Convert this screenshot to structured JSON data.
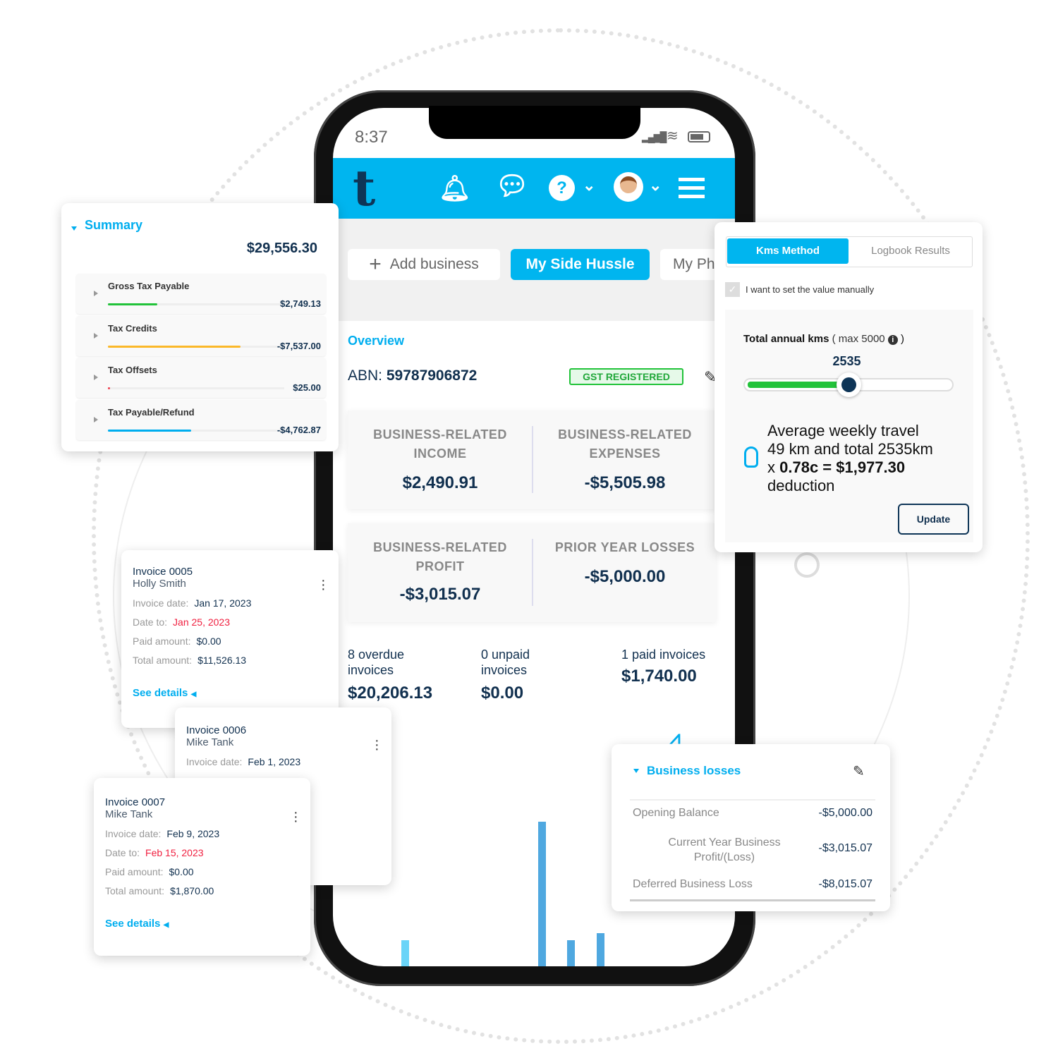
{
  "status_bar": {
    "time": "8:37"
  },
  "header": {
    "icons": [
      "logo-t",
      "bell-icon",
      "chat-icon",
      "help-icon",
      "avatar",
      "menu-icon"
    ],
    "help_glyph": "?"
  },
  "business_tabs": {
    "add": "Add business",
    "active": "My Side Hussle",
    "next": "My Ph"
  },
  "overview": {
    "title": "Overview",
    "abn_label": "ABN:",
    "abn": "59787906872",
    "badge": "GST REGISTERED",
    "stats": [
      {
        "label": "BUSINESS-RELATED INCOME",
        "value": "$2,490.91"
      },
      {
        "label": "BUSINESS-RELATED EXPENSES",
        "value": "-$5,505.98"
      },
      {
        "label": "BUSINESS-RELATED PROFIT",
        "value": "-$3,015.07"
      },
      {
        "label": "PRIOR YEAR LOSSES",
        "value": "-$5,000.00"
      }
    ],
    "invoices": [
      {
        "label": "8 overdue invoices",
        "value": "$20,206.13"
      },
      {
        "label": "0 unpaid invoices",
        "value": "$0.00"
      },
      {
        "label": "1 paid invoices",
        "value": "$1,740.00"
      }
    ]
  },
  "chart_bars": [
    0.18,
    1.0,
    0.18,
    0.23
  ],
  "summary": {
    "title": "Summary",
    "total": "$29,556.30",
    "rows": [
      {
        "label": "Gross Tax Payable",
        "value": "$2,749.13",
        "fill": 0.28,
        "color": "#22c33a"
      },
      {
        "label": "Tax Credits",
        "value": "-$7,537.00",
        "fill": 0.75,
        "color": "#fbb829"
      },
      {
        "label": "Tax Offsets",
        "value": "$25.00",
        "fill": 0.01,
        "color": "#f04050"
      },
      {
        "label": "Tax Payable/Refund",
        "value": "-$4,762.87",
        "fill": 0.47,
        "color": "#00aeef"
      }
    ]
  },
  "kms": {
    "tab_active": "Kms Method",
    "tab_other": "Logbook Results",
    "checkbox": "I want to set the value manually",
    "checked": true,
    "label_bold": "Total annual kms",
    "label_rest": "( max 5000",
    "label_end": ")",
    "value": "2535",
    "max": 5000,
    "tip_l1": "Average weekly travel",
    "tip_l2": "49 km and total 2535km",
    "tip_x": "x",
    "tip_bold": "0.78c = $1,977.30",
    "tip_l4": "deduction",
    "update": "Update"
  },
  "invoices": [
    {
      "title": "Invoice 0005",
      "name": "Holly Smith",
      "invoice_date_label": "Invoice date:",
      "invoice_date": "Jan 17, 2023",
      "date_to_label": "Date to:",
      "date_to": "Jan 25, 2023",
      "paid_label": "Paid amount:",
      "paid": "$0.00",
      "total_label": "Total amount:",
      "total": "$11,526.13",
      "details": "See details"
    },
    {
      "title": "Invoice 0006",
      "name": "Mike Tank",
      "invoice_date_label": "Invoice date:",
      "invoice_date": "Feb 1, 2023"
    },
    {
      "title": "Invoice 0007",
      "name": "Mike Tank",
      "invoice_date_label": "Invoice date:",
      "invoice_date": "Feb 9, 2023",
      "date_to_label": "Date to:",
      "date_to": "Feb 15, 2023",
      "paid_label": "Paid amount:",
      "paid": "$0.00",
      "total_label": "Total amount:",
      "total": "$1,870.00",
      "details": "See details"
    }
  ],
  "losses": {
    "title": "Business losses",
    "rows": [
      {
        "label": "Opening Balance",
        "value": "-$5,000.00"
      },
      {
        "label": "Current Year Business Profit/(Loss)",
        "value": "-$3,015.07"
      },
      {
        "label": "Deferred Business Loss",
        "value": "-$8,015.07"
      }
    ]
  }
}
